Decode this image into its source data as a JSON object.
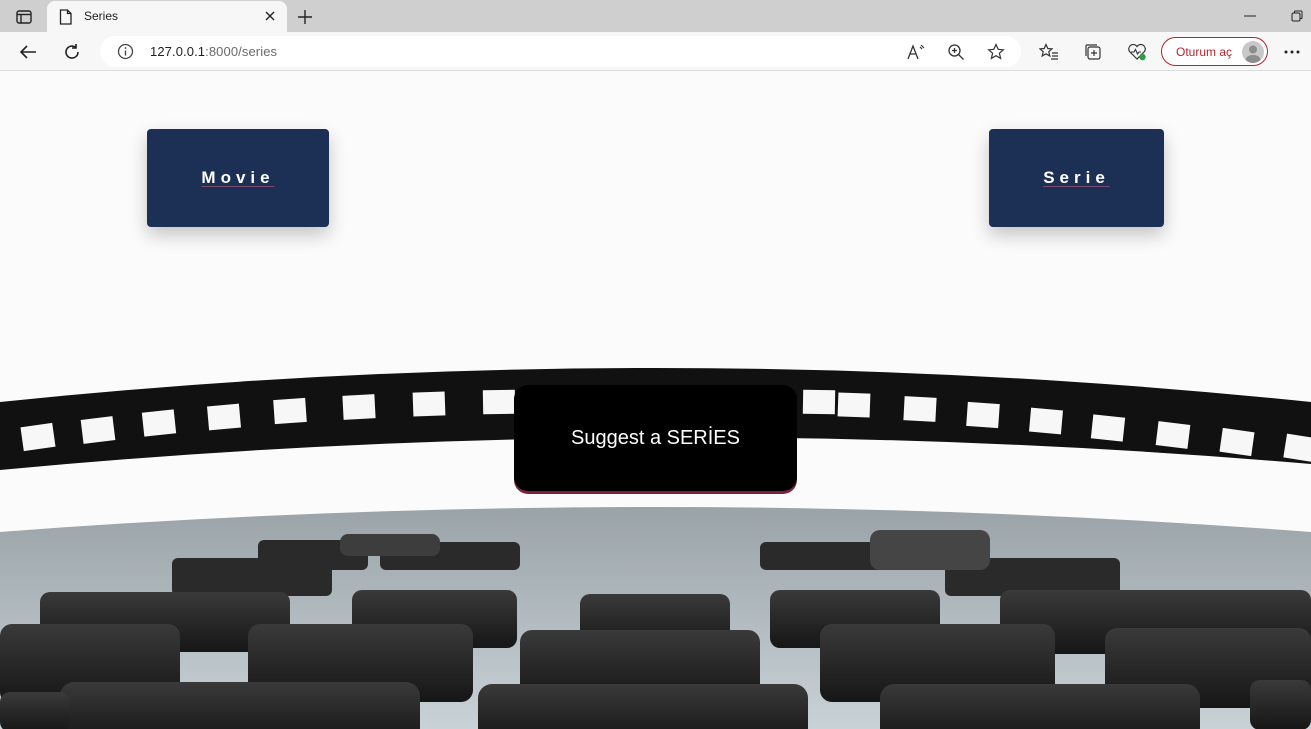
{
  "browser": {
    "tab_title": "Series",
    "url_host": "127.0.0.1",
    "url_rest": ":8000/series",
    "signin_label": "Oturum aç"
  },
  "page": {
    "nav_movie_label": "Movie",
    "nav_serie_label": "Serie",
    "suggest_label": "Suggest a SERİES"
  },
  "colors": {
    "nav_button_bg": "#1b3054",
    "suggest_bg": "#000000",
    "signin_accent": "#b3262d"
  },
  "icons": {
    "tab_actions": "tab-actions-icon",
    "page": "page-icon",
    "close": "close-icon",
    "new_tab": "plus-icon",
    "back": "back-arrow-icon",
    "refresh": "refresh-icon",
    "info": "info-icon",
    "read_aloud": "read-aloud-icon",
    "zoom": "zoom-icon",
    "favorite": "star-icon",
    "favorites": "favorites-icon",
    "collections": "collections-icon",
    "performance": "heart-pulse-icon",
    "more": "more-icon"
  }
}
